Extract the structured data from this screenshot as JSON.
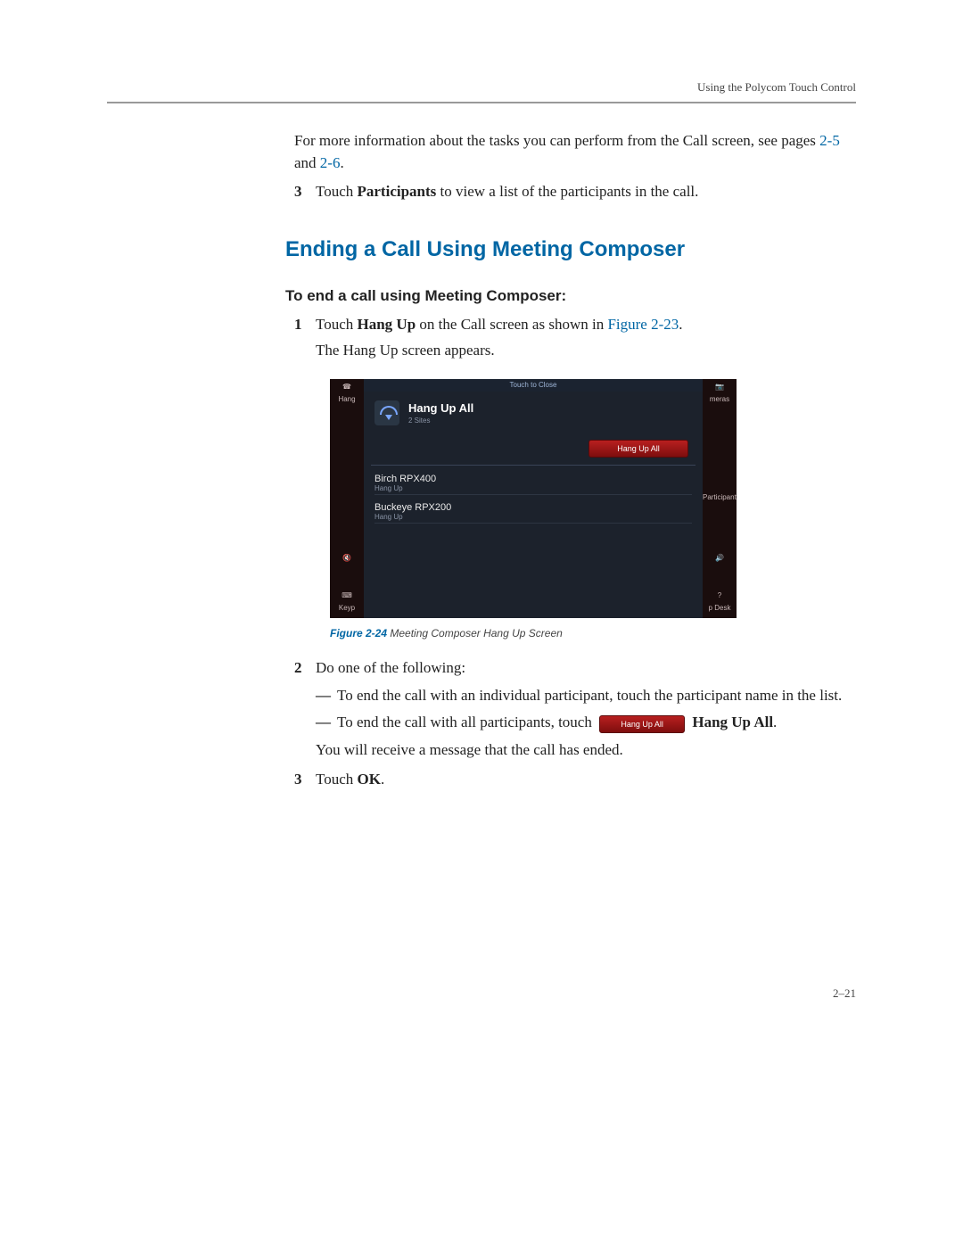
{
  "running_head": "Using the Polycom Touch Control",
  "intro_para_part1": "For more information about the tasks you can perform from the Call screen, see pages ",
  "intro_link1": "2-5",
  "intro_and": " and ",
  "intro_link2": "2-6",
  "intro_period": ".",
  "step3_top_num": "3",
  "step3_top_pre": "Touch ",
  "step3_top_bold": "Participants",
  "step3_top_post": " to view a list of the participants in the call.",
  "section_heading": "Ending a Call Using Meeting Composer",
  "task_heading": "To end a call using Meeting Composer:",
  "s1_num": "1",
  "s1_pre": "Touch ",
  "s1_bold": "Hang Up",
  "s1_mid": " on the Call screen as shown in ",
  "s1_link": "Figure 2-23",
  "s1_post": ".",
  "s1_cont": "The Hang Up screen appears.",
  "screenshot": {
    "touch_to_close": "Touch to Close",
    "left_hang": "Hang",
    "right_cameras": "meras",
    "left_keypad": "Keyp",
    "right_desk": "p Desk",
    "title": "Hang Up All",
    "subtitle": "2 Sites",
    "button": "Hang Up All",
    "rows": [
      {
        "name": "Birch RPX400",
        "sub": "Hang Up"
      },
      {
        "name": "Buckeye RPX200",
        "sub": "Hang Up"
      }
    ],
    "participants": "Participants",
    "question": "?"
  },
  "figure_num": "Figure 2-24",
  "figure_title": "  Meeting Composer Hang Up Screen",
  "s2_num": "2",
  "s2_text": "Do one of the following:",
  "s2a_text": "To end the call with an individual participant, touch the participant name in the list.",
  "s2b_pre": "To end the call with all participants, touch ",
  "s2b_btn": "Hang Up All",
  "s2b_bold": " Hang Up All",
  "s2b_post": ".",
  "s2_after": "You will receive a message that the call has ended.",
  "s3_num": "3",
  "s3_pre": "Touch ",
  "s3_bold": "OK",
  "s3_post": ".",
  "page_num": "2–21"
}
